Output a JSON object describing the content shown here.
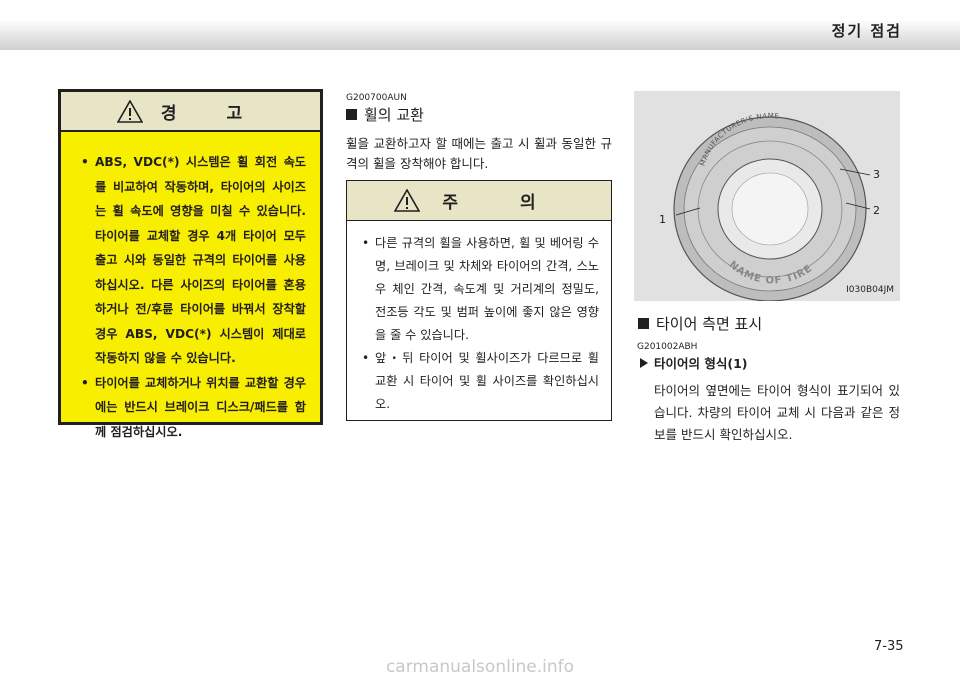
{
  "header": {
    "title": "정기 점검"
  },
  "warning": {
    "title": "경 고",
    "items": [
      "ABS, VDC(*) 시스템은 휠 회전 속도를 비교하여 작동하며, 타이어의 사이즈는 휠 속도에 영향을 미칠 수 있습니다. 타이어를 교체할 경우 4개 타이어 모두 출고 시와 동일한 규격의 타이어를 사용하십시오. 다른 사이즈의 타이어를 혼용하거나 전/후륜 타이어를 바꿔서 장착할 경우 ABS, VDC(*) 시스템이 제대로 작동하지 않을 수 있습니다.",
      "타이어를 교체하거나 위치를 교환할 경우에는 반드시 브레이크 디스크/패드를 함께 점검하십시오."
    ]
  },
  "wheel_section": {
    "code": "G200700AUN",
    "title": "휠의 교환",
    "body": "휠을 교환하고자 할 때에는 출고 시 휠과 동일한 규격의 휠을 장착해야 합니다."
  },
  "caution": {
    "title": "주 의",
    "items": [
      "다른 규격의 휠을 사용하면, 휠 및 베어링 수명, 브레이크 및 차체와 타이어의 간격, 스노우 체인 간격, 속도계 및 거리계의 정밀도, 전조등 각도 및 범퍼 높이에 좋지 않은 영향을 줄 수 있습니다.",
      "앞・뒤 타이어 및 휠사이즈가 다르므로 휠 교환 시 타이어 및 휠 사이즈를 확인하십시오."
    ]
  },
  "tire_figure": {
    "id": "I030B04JM",
    "callouts": [
      "1",
      "2",
      "3"
    ],
    "tire_text_top": "MANUFACTURER'S NAME",
    "tire_text_bottom": "NAME OF TIRE"
  },
  "sidewall_section": {
    "title": "타이어 측면 표시",
    "code": "G201002ABH",
    "subtitle": "타이어의 형식(1)",
    "body": "타이어의 옆면에는 타이어 형식이 표기되어 있습니다. 차량의 타이어 교체 시 다음과 같은 정보를 반드시 확인하십시오."
  },
  "page_number": "7-35",
  "watermark": "carmanualsonline.info"
}
